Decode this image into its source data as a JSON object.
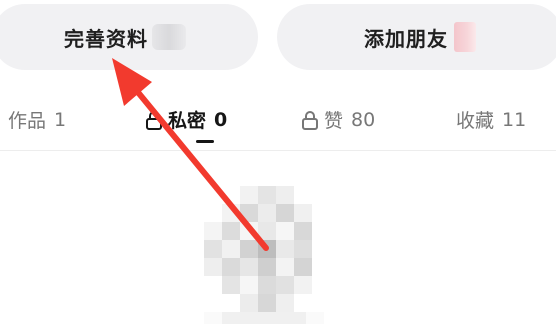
{
  "actions": {
    "edit_profile_label": "完善资料",
    "add_friend_label": "添加朋友"
  },
  "tabs": [
    {
      "label": "作品",
      "count": "1"
    },
    {
      "label": "私密",
      "count": "0"
    },
    {
      "label": "赞",
      "count": "80"
    },
    {
      "label": "收藏",
      "count": "11"
    }
  ],
  "active_tab": "私密",
  "icons": {
    "private_tab": "lock-icon",
    "likes_tab": "lock-icon"
  },
  "colors": {
    "annotation_arrow": "#f23a2e",
    "pill_background": "#f1f1f3",
    "active_tab_text": "#161616",
    "inactive_tab_text": "#777777"
  }
}
